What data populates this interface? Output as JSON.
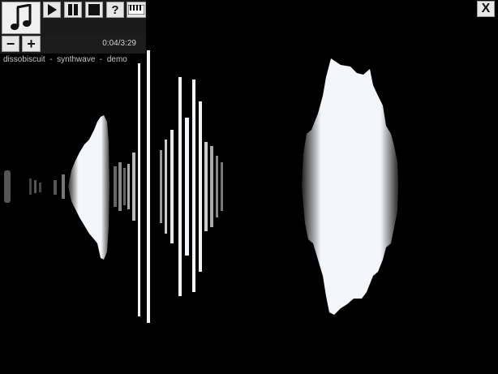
{
  "player": {
    "time": "0:04/3:29",
    "track": "dissobiscuit  -  synthwave  -  demo",
    "help_label": "?",
    "minus_label": "−",
    "plus_label": "+",
    "close_label": "X"
  },
  "colors": {
    "background": "#000000",
    "wave": "#f2f6f8",
    "panel": "#1c1c1c"
  },
  "icons": [
    "music-note-icon",
    "play-icon",
    "pause-icon",
    "stop-icon",
    "help-icon",
    "keyboard-icon",
    "minus-icon",
    "plus-icon",
    "close-icon"
  ]
}
